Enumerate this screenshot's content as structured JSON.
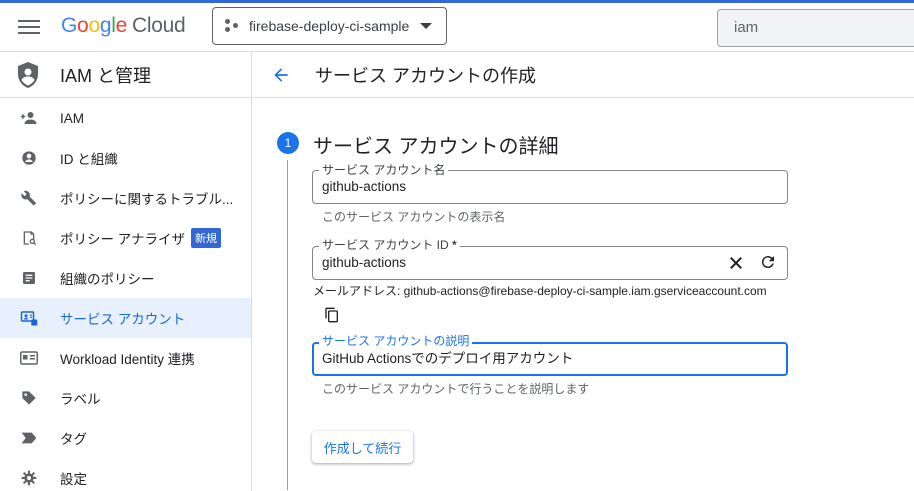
{
  "topbar": {
    "logo": {
      "google": [
        "G",
        "o",
        "o",
        "g",
        "l",
        "e"
      ],
      "product": "Cloud"
    },
    "project_name": "firebase-deploy-ci-sample",
    "search_value": "iam"
  },
  "sidebar": {
    "title": "IAM と管理",
    "items": [
      {
        "label": "IAM",
        "icon": "person-add-icon"
      },
      {
        "label": "ID と組織",
        "icon": "account-circle-icon"
      },
      {
        "label": "ポリシーに関するトラブル...",
        "icon": "wrench-icon"
      },
      {
        "label": "ポリシー アナライザ",
        "icon": "policy-analyzer-icon",
        "badge": "新規"
      },
      {
        "label": "組織のポリシー",
        "icon": "article-icon"
      },
      {
        "label": "サービス アカウント",
        "icon": "service-account-icon",
        "active": true
      },
      {
        "label": "Workload Identity 連携",
        "icon": "id-card-icon"
      },
      {
        "label": "ラベル",
        "icon": "tag-icon"
      },
      {
        "label": "タグ",
        "icon": "label-arrow-icon"
      },
      {
        "label": "設定",
        "icon": "gear-icon"
      }
    ]
  },
  "page": {
    "title": "サービス アカウントの作成",
    "step_number": "1",
    "step_title": "サービス アカウントの詳細",
    "name_field": {
      "label": "サービス アカウント名",
      "value": "github-actions",
      "help": "このサービス アカウントの表示名"
    },
    "id_field": {
      "label": "サービス アカウント ID",
      "required_mark": " *",
      "value": "github-actions"
    },
    "email": "メールアドレス: github-actions@firebase-deploy-ci-sample.iam.gserviceaccount.com",
    "desc_field": {
      "label": "サービス アカウントの説明",
      "value": "GitHub Actionsでのデプロイ用アカウント",
      "help": "このサービス アカウントで行うことを説明します"
    },
    "continue_button": "作成して続行"
  },
  "colors": {
    "accent": "#1a73e8",
    "active_bg": "#e8f0fe",
    "badge": "#3367d6"
  }
}
